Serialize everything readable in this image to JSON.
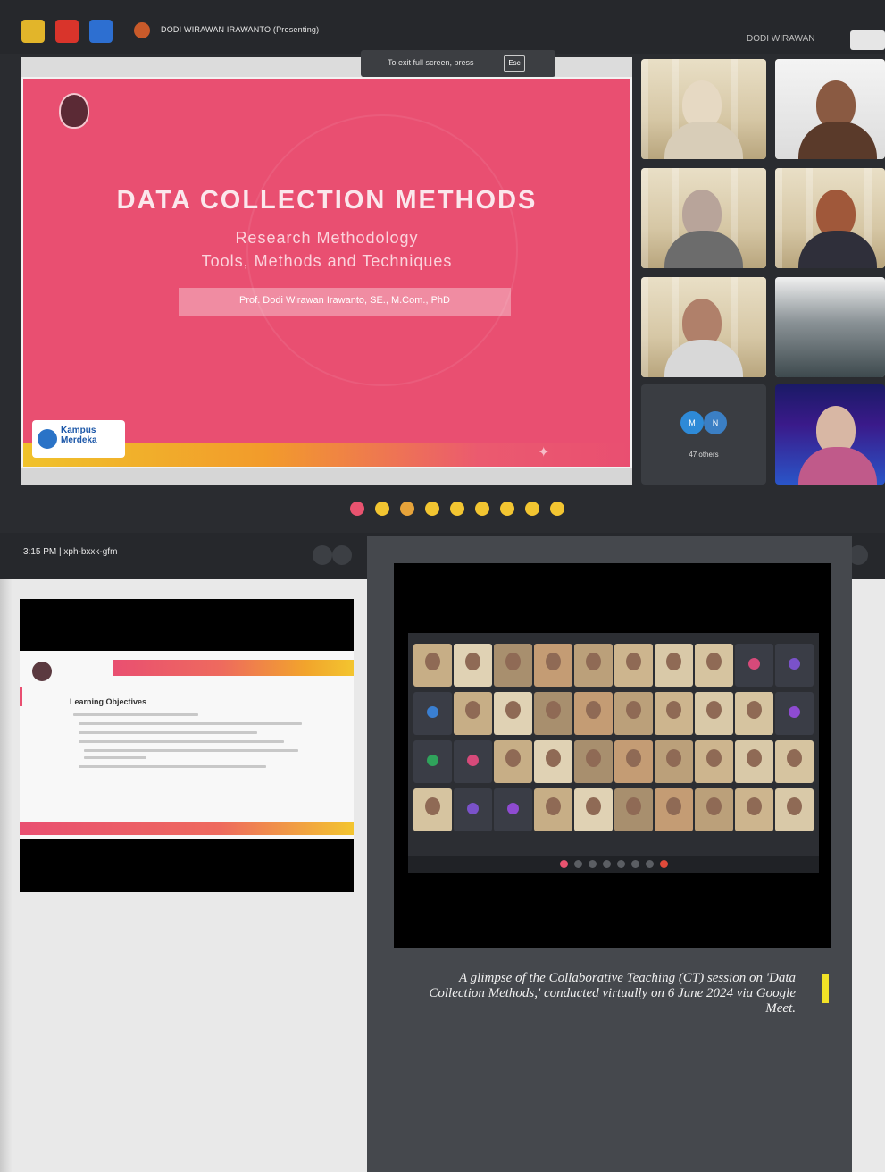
{
  "meet": {
    "presenter_label": "DODI WIRAWAN IRAWANTO (Presenting)",
    "top_right_name": "DODI WIRAWAN",
    "fullscreen_hint": "To exit full screen, press",
    "fullscreen_key": "Esc",
    "meeting_info": "3:15 PM  |  xph-bxxk-gfm",
    "others_label": "47 others",
    "avatar_1": "M",
    "avatar_2": "N"
  },
  "slide": {
    "title": "DATA COLLECTION METHODS",
    "subtitle_1": "Research Methodology",
    "subtitle_2": "Tools, Methods and Techniques",
    "author": "Prof. Dodi Wirawan Irawanto, SE., M.Com., PhD",
    "kampus_logo_text": "Kampus Merdeka"
  },
  "doc_slide": {
    "title": "Learning Objectives"
  },
  "caption": {
    "text": "A glimpse of the Collaborative Teaching (CT) session on 'Data Collection Methods,' conducted virtually on 6 June 2024 via Google Meet."
  },
  "colors": {
    "slide_pink": "#e94f71",
    "accent_yellow": "#f2e227",
    "meet_dark": "#26282c"
  }
}
